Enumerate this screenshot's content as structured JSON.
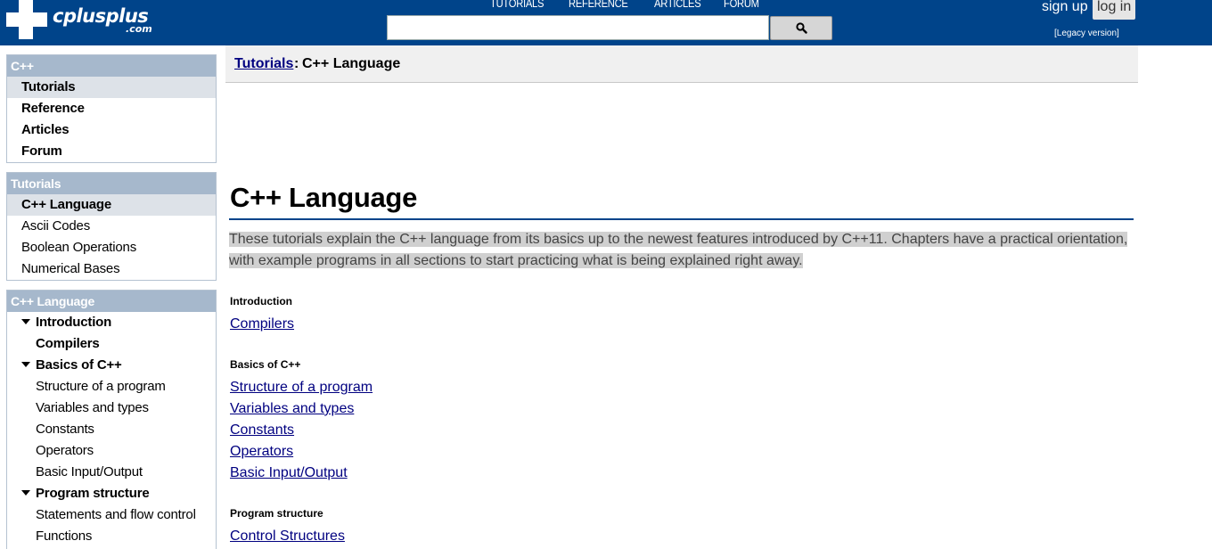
{
  "header": {
    "logo_text": "cplusplus",
    "logo_suffix": ".com",
    "nav": [
      "TUTORIALS",
      "REFERENCE",
      "ARTICLES",
      "FORUM"
    ],
    "search_placeholder": "",
    "search_icon": "search-icon",
    "sign_up": "sign up",
    "log_in": "log in",
    "legacy": "[Legacy version]",
    "colors": {
      "bar": "#00448a"
    }
  },
  "sidebar": {
    "boxes": [
      {
        "title": "C++",
        "items": [
          {
            "label": "Tutorials",
            "selected": true
          },
          {
            "label": "Reference"
          },
          {
            "label": "Articles"
          },
          {
            "label": "Forum"
          }
        ]
      },
      {
        "title": "Tutorials",
        "items": [
          {
            "label": "C++ Language",
            "selected": true
          },
          {
            "label": "Ascii Codes"
          },
          {
            "label": "Boolean Operations"
          },
          {
            "label": "Numerical Bases"
          }
        ]
      },
      {
        "title": "C++ Language",
        "items": [
          {
            "label": "Introduction",
            "expanded": true
          },
          {
            "label": "Compilers"
          },
          {
            "label": "Basics of C++",
            "expanded": true
          },
          {
            "label": "Structure of a program"
          },
          {
            "label": "Variables and types"
          },
          {
            "label": "Constants"
          },
          {
            "label": "Operators"
          },
          {
            "label": "Basic Input/Output"
          },
          {
            "label": "Program structure",
            "expanded": true
          },
          {
            "label": "Statements and flow control"
          },
          {
            "label": "Functions"
          }
        ]
      }
    ]
  },
  "breadcrumb": {
    "link": "Tutorials",
    "separator": ":",
    "current": "C++ Language"
  },
  "main": {
    "title": "C++ Language",
    "intro_line1": "These tutorials explain the C++ language from its basics up to the newest features introduced by C++11. Chapters have a practical orientation,",
    "intro_line2": "with example programs in all sections to start practicing what is being explained right away.",
    "sections": [
      {
        "heading": "Introduction",
        "links": [
          "Compilers"
        ]
      },
      {
        "heading": "Basics of C++",
        "links": [
          "Structure of a program",
          "Variables and types",
          "Constants",
          "Operators",
          "Basic Input/Output"
        ]
      },
      {
        "heading": "Program structure",
        "links": [
          "Control Structures"
        ]
      }
    ]
  }
}
